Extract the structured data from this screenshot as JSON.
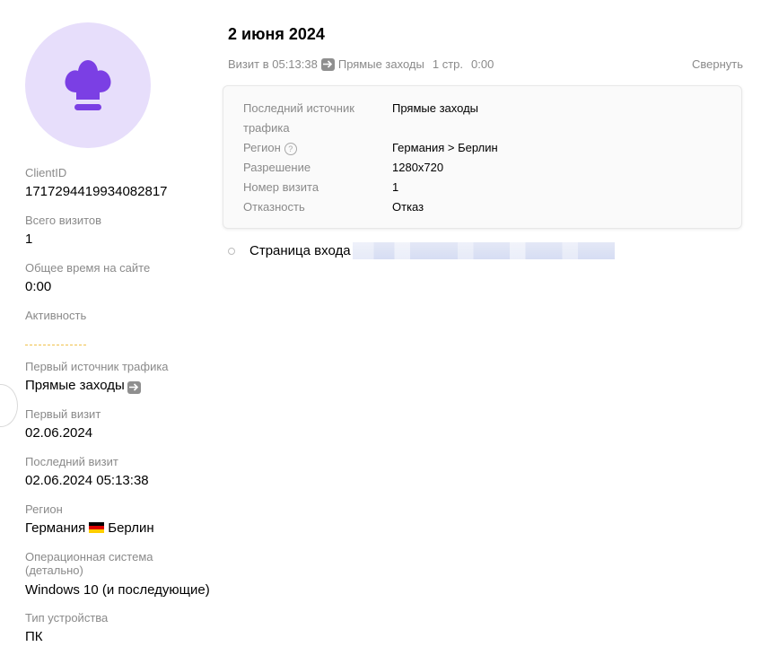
{
  "profile": {
    "client_id_label": "ClientID",
    "client_id": "1717294419934082817",
    "total_visits_label": "Всего визитов",
    "total_visits": "1",
    "total_time_label": "Общее время на сайте",
    "total_time": "0:00",
    "activity_label": "Активность",
    "first_source_label": "Первый источник трафика",
    "first_source": "Прямые заходы",
    "first_visit_label": "Первый визит",
    "first_visit": "02.06.2024",
    "last_visit_label": "Последний визит",
    "last_visit": "02.06.2024 05:13:38",
    "region_label": "Регион",
    "region_country": "Германия",
    "region_city": "Берлин",
    "os_label": "Операционная система (детально)",
    "os": "Windows 10 (и последующие)",
    "device_label": "Тип устройства",
    "device": "ПК",
    "avatar_icon": "chef-hat-icon",
    "avatar_color": "#7b3fe4",
    "avatar_bg": "#e7defb"
  },
  "visit": {
    "date_title": "2 июня 2024",
    "time_text": "Визит в 05:13:38",
    "source_text": "Прямые заходы",
    "pages_text": "1 стр.",
    "duration_text": "0:00",
    "collapse_label": "Свернуть",
    "details": {
      "last_source_label": "Последний источник трафика",
      "last_source": "Прямые заходы",
      "region_label": "Регион",
      "region": "Германия > Берлин",
      "resolution_label": "Разрешение",
      "resolution": "1280x720",
      "visit_number_label": "Номер визита",
      "visit_number": "1",
      "bounce_label": "Отказность",
      "bounce": "Отказ"
    },
    "entry_page_label": "Страница входа"
  }
}
